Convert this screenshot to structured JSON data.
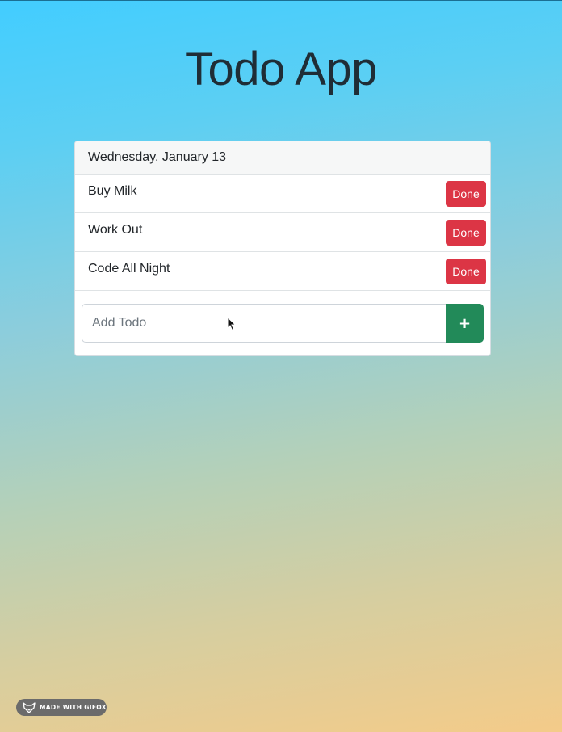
{
  "app": {
    "title": "Todo App"
  },
  "card": {
    "date": "Wednesday, January 13"
  },
  "todos": [
    {
      "text": "Buy Milk",
      "button_label": "Done"
    },
    {
      "text": "Work Out",
      "button_label": "Done"
    },
    {
      "text": "Code All Night",
      "button_label": "Done"
    }
  ],
  "add_form": {
    "placeholder": "Add Todo",
    "value": "",
    "submit_label": "+"
  },
  "watermark": {
    "text": "MADE WITH GIFOX",
    "icon": "fox-icon"
  },
  "colors": {
    "done_button": "#dc3545",
    "add_button": "#228a59",
    "gradient_top": "#42cdff",
    "gradient_bottom": "#f4cb89"
  }
}
